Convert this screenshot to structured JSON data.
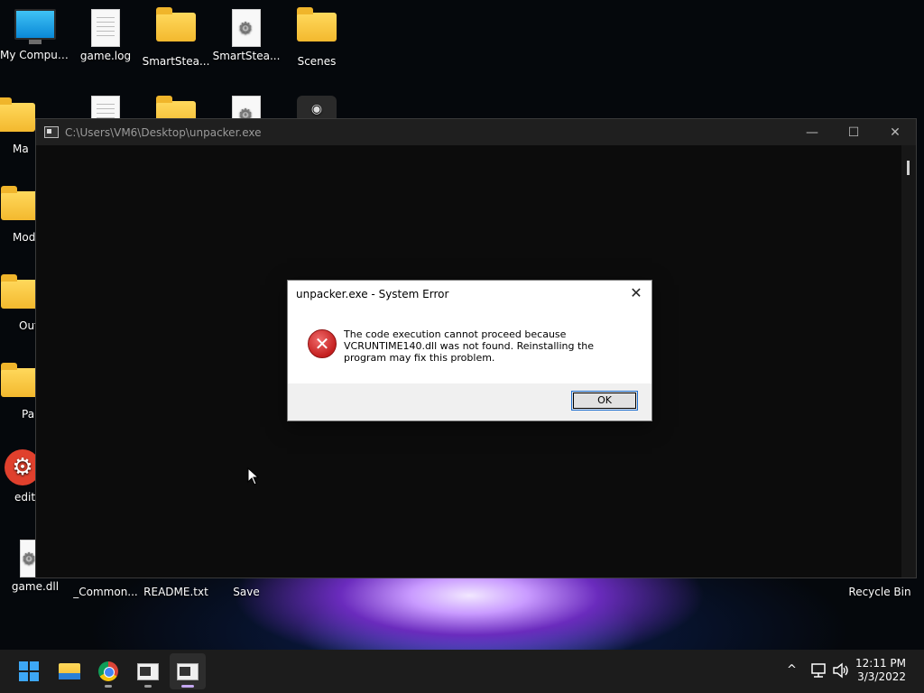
{
  "desktop": {
    "icons": [
      {
        "label": "My Computer"
      },
      {
        "label": "game.log"
      },
      {
        "label": "SmartStea..."
      },
      {
        "label": "SmartStea..."
      },
      {
        "label": "Scenes"
      },
      {
        "label": "Ma"
      },
      {
        "label": "Mod"
      },
      {
        "label": "Out"
      },
      {
        "label": "Pa"
      },
      {
        "label": "editH"
      },
      {
        "label": "game.dll"
      },
      {
        "label": "_Common..."
      },
      {
        "label": "README.txt"
      },
      {
        "label": "Save"
      },
      {
        "label": "Recycle Bin"
      }
    ]
  },
  "console": {
    "title": "C:\\Users\\VM6\\Desktop\\unpacker.exe",
    "minimize": "—",
    "maximize": "☐",
    "close": "✕"
  },
  "dialog": {
    "title": "unpacker.exe - System Error",
    "close": "✕",
    "message": "The code execution cannot proceed because VCRUNTIME140.dll was not found. Reinstalling the program may fix this problem.",
    "ok_label": "OK"
  },
  "taskbar": {
    "tray_chevron": "^",
    "clock_time": "12:11 PM",
    "clock_date": "3/3/2022"
  }
}
